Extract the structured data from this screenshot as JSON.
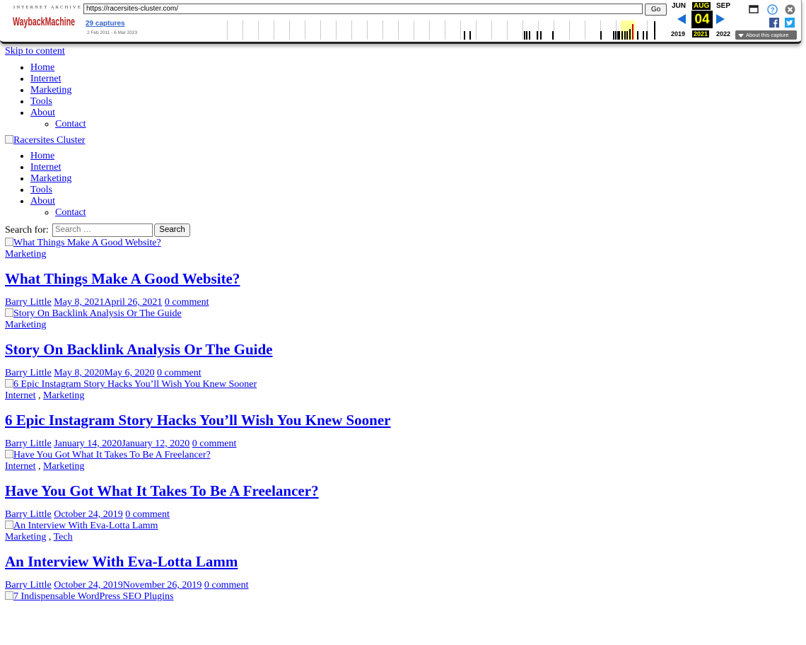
{
  "wayback": {
    "ia_label": "INTERNET ARCHIVE",
    "logo_text": "WaybackMachine",
    "url": "https://racersites-cluster.com/",
    "go_label": "Go",
    "captures": "29 captures",
    "range": "2 Feb 2011 - 6 Mar 2023",
    "month_prev": "JUN",
    "month_cur": "AUG",
    "month_next": "SEP",
    "day": "04",
    "year_prev": "2019",
    "year_cur": "2021",
    "year_next": "2022",
    "about_label": "About this capture",
    "accent": "#1a6fd1",
    "highlight": "#ffff00"
  },
  "skip_link": "Skip to content",
  "nav": [
    "Home",
    "Internet",
    "Marketing",
    "Tools",
    "About"
  ],
  "nav_sub": [
    "Contact"
  ],
  "site_logo_alt": "Racersites Cluster",
  "search": {
    "label": "Search for:",
    "placeholder": "Search …",
    "button": "Search"
  },
  "posts": [
    {
      "image_alt": "What Things Make A Good Website?",
      "categories": [
        "Marketing"
      ],
      "title": "What Things Make A Good Website?",
      "author": "Barry Little",
      "date": "May 8, 2021April 26, 2021",
      "comments": "0 comment"
    },
    {
      "image_alt": "Story On Backlink Analysis Or The Guide",
      "categories": [
        "Marketing"
      ],
      "title": "Story On Backlink Analysis Or The Guide",
      "author": "Barry Little",
      "date": "May 8, 2020May 6, 2020",
      "comments": "0 comment"
    },
    {
      "image_alt": "6 Epic Instagram Story Hacks You’ll Wish You Knew Sooner",
      "categories": [
        "Internet",
        "Marketing"
      ],
      "title": "6 Epic Instagram Story Hacks You’ll Wish You Knew Sooner",
      "author": "Barry Little",
      "date": "January 14, 2020January 12, 2020",
      "comments": "0 comment"
    },
    {
      "image_alt": "Have You Got What It Takes To Be A Freelancer?",
      "categories": [
        "Internet",
        "Marketing"
      ],
      "title": "Have You Got What It Takes To Be A Freelancer?",
      "author": "Barry Little",
      "date": "October 24, 2019",
      "comments": "0 comment"
    },
    {
      "image_alt": "An Interview With Eva-Lotta Lamm",
      "categories": [
        "Marketing",
        "Tech"
      ],
      "title": "An Interview With Eva-Lotta Lamm",
      "author": "Barry Little",
      "date": "October 24, 2019November 26, 2019",
      "comments": "0 comment"
    },
    {
      "image_alt": "7 Indispensable WordPress SEO Plugins"
    }
  ]
}
